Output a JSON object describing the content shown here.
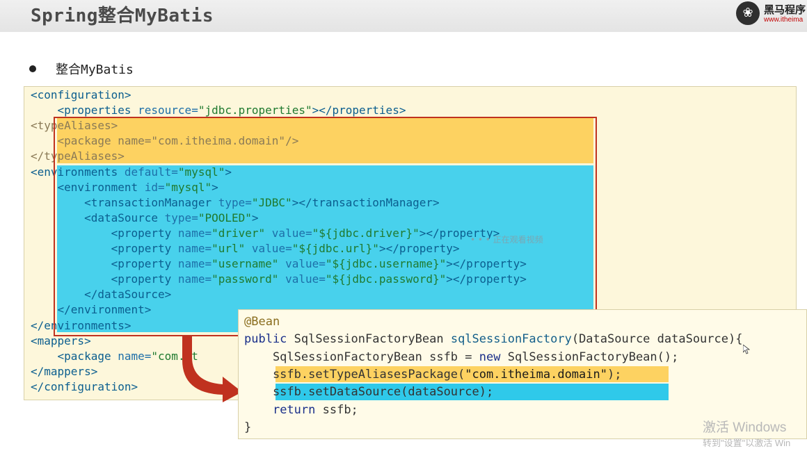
{
  "header": {
    "title": "Spring整合MyBatis",
    "logo_glyph": "❀",
    "logo_name": "黑马程序",
    "logo_url": "www.itheima"
  },
  "bullet": {
    "text": "整合MyBatis"
  },
  "xml_lines": [
    [
      [
        "tg",
        "<configuration>"
      ]
    ],
    [
      [
        "pl",
        "    "
      ],
      [
        "tg",
        "<properties "
      ],
      [
        "at",
        "resource="
      ],
      [
        "vl",
        "\"jdbc.properties\""
      ],
      [
        "tg",
        "></properties>"
      ]
    ],
    [
      [
        "tg",
        "<typeAliases>"
      ]
    ],
    [
      [
        "pl",
        "    "
      ],
      [
        "tg",
        "<package "
      ],
      [
        "at",
        "name="
      ],
      [
        "vl",
        "\"com.itheima.domain\""
      ],
      [
        "tg",
        "/>"
      ]
    ],
    [
      [
        "tg",
        "</typeAliases>"
      ]
    ],
    [
      [
        "tg",
        "<environments "
      ],
      [
        "at",
        "default="
      ],
      [
        "vl",
        "\"mysql\""
      ],
      [
        "tg",
        ">"
      ]
    ],
    [
      [
        "pl",
        "    "
      ],
      [
        "tg",
        "<environment "
      ],
      [
        "at",
        "id="
      ],
      [
        "vl",
        "\"mysql\""
      ],
      [
        "tg",
        ">"
      ]
    ],
    [
      [
        "pl",
        "        "
      ],
      [
        "tg",
        "<transactionManager "
      ],
      [
        "at",
        "type="
      ],
      [
        "vl",
        "\"JDBC\""
      ],
      [
        "tg",
        "></transactionManager>"
      ]
    ],
    [
      [
        "pl",
        "        "
      ],
      [
        "tg",
        "<dataSource "
      ],
      [
        "at",
        "type="
      ],
      [
        "vl",
        "\"POOLED\""
      ],
      [
        "tg",
        ">"
      ]
    ],
    [
      [
        "pl",
        "            "
      ],
      [
        "tg",
        "<property "
      ],
      [
        "at",
        "name="
      ],
      [
        "vl",
        "\"driver\""
      ],
      [
        "pl",
        " "
      ],
      [
        "at",
        "value="
      ],
      [
        "vl",
        "\"${jdbc.driver}\""
      ],
      [
        "tg",
        "></property>"
      ]
    ],
    [
      [
        "pl",
        "            "
      ],
      [
        "tg",
        "<property "
      ],
      [
        "at",
        "name="
      ],
      [
        "vl",
        "\"url\""
      ],
      [
        "pl",
        " "
      ],
      [
        "at",
        "value="
      ],
      [
        "vl",
        "\"${jdbc.url}\""
      ],
      [
        "tg",
        "></property>"
      ]
    ],
    [
      [
        "pl",
        "            "
      ],
      [
        "tg",
        "<property "
      ],
      [
        "at",
        "name="
      ],
      [
        "vl",
        "\"username\""
      ],
      [
        "pl",
        " "
      ],
      [
        "at",
        "value="
      ],
      [
        "vl",
        "\"${jdbc.username}\""
      ],
      [
        "tg",
        "></property>"
      ]
    ],
    [
      [
        "pl",
        "            "
      ],
      [
        "tg",
        "<property "
      ],
      [
        "at",
        "name="
      ],
      [
        "vl",
        "\"password\""
      ],
      [
        "pl",
        " "
      ],
      [
        "at",
        "value="
      ],
      [
        "vl",
        "\"${jdbc.password}\""
      ],
      [
        "tg",
        "></property>"
      ]
    ],
    [
      [
        "pl",
        "        "
      ],
      [
        "tg",
        "</dataSource>"
      ]
    ],
    [
      [
        "pl",
        "    "
      ],
      [
        "tg",
        "</environment>"
      ]
    ],
    [
      [
        "tg",
        "</environments>"
      ]
    ],
    [
      [
        "tg",
        "<mappers>"
      ]
    ],
    [
      [
        "pl",
        "    "
      ],
      [
        "tg",
        "<package "
      ],
      [
        "at",
        "name="
      ],
      [
        "vl",
        "\"com.it"
      ]
    ],
    [
      [
        "tg",
        "</mappers>"
      ]
    ],
    [
      [
        "tg",
        "</configuration>"
      ]
    ]
  ],
  "java_lines": [
    [
      [
        "ann",
        "@Bean"
      ]
    ],
    [
      [
        "kw",
        "public "
      ],
      [
        "pl",
        "SqlSessionFactoryBean "
      ],
      [
        "mth",
        "sqlSessionFactory"
      ],
      [
        "pl",
        "(DataSource dataSource){"
      ]
    ],
    [
      [
        "pl",
        "    SqlSessionFactoryBean ssfb = "
      ],
      [
        "kw",
        "new "
      ],
      [
        "pl",
        "SqlSessionFactoryBean();"
      ]
    ],
    [
      [
        "pl",
        "    ssfb.setTypeAliasesPackage("
      ],
      [
        "jstr",
        "\"com.itheima.domain\""
      ],
      [
        "pl",
        ");"
      ]
    ],
    [
      [
        "pl",
        "    ssfb.setDataSource(dataSource);"
      ]
    ],
    [
      [
        "pl",
        "    "
      ],
      [
        "kw",
        "return "
      ],
      [
        "pl",
        "ssfb;"
      ]
    ],
    [
      [
        "pl",
        "}"
      ]
    ]
  ],
  "overlay": {
    "mid_watermark": "• • • 正在观看视频"
  },
  "windows_watermark": {
    "line1": "激活 Windows",
    "line2": "转到\"设置\"以激活 Win"
  },
  "colors": {
    "highlight_yellow": "#fdd261",
    "highlight_blue": "#48d1ec",
    "box_red": "#c0321f",
    "arrow_red": "#c0321f"
  }
}
